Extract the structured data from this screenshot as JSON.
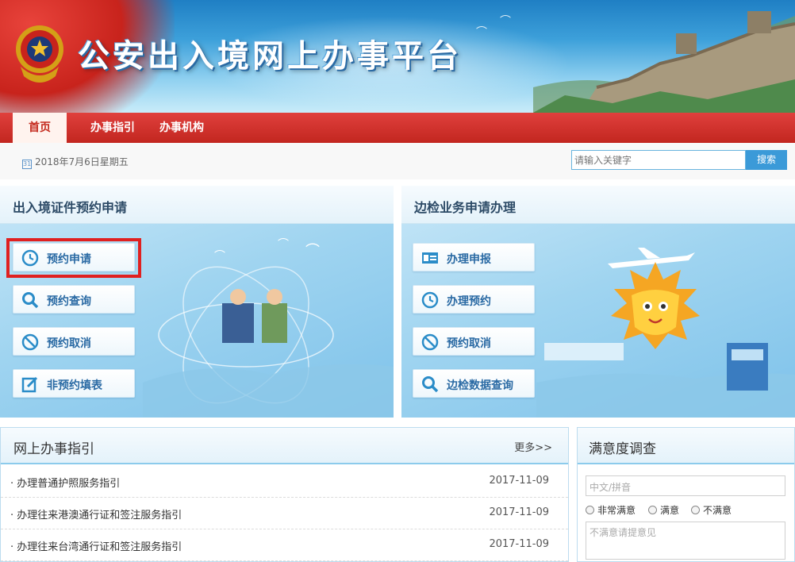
{
  "header": {
    "title": "公安出入境网上办事平台"
  },
  "nav": {
    "items": [
      {
        "label": "首页",
        "active": true
      },
      {
        "label": "办事指引",
        "active": false
      },
      {
        "label": "办事机构",
        "active": false
      }
    ]
  },
  "info": {
    "date": "2018年7月6日星期五",
    "search_placeholder": "请输入关键字",
    "search_button": "搜索"
  },
  "left_panel": {
    "title": "出入境证件预约申请",
    "buttons": [
      {
        "label": "预约申请",
        "icon": "clock-icon"
      },
      {
        "label": "预约查询",
        "icon": "search-icon"
      },
      {
        "label": "预约取消",
        "icon": "cancel-icon"
      },
      {
        "label": "非预约填表",
        "icon": "edit-icon"
      }
    ]
  },
  "right_panel": {
    "title": "边检业务申请办理",
    "buttons": [
      {
        "label": "办理申报",
        "icon": "id-card-icon"
      },
      {
        "label": "办理预约",
        "icon": "clock-icon"
      },
      {
        "label": "预约取消",
        "icon": "cancel-icon"
      },
      {
        "label": "边检数据查询",
        "icon": "search-icon"
      }
    ]
  },
  "guide": {
    "title": "网上办事指引",
    "more": "更多>>",
    "items": [
      {
        "title": "· 办理普通护照服务指引",
        "date": "2017-11-09"
      },
      {
        "title": "· 办理往来港澳通行证和签注服务指引",
        "date": "2017-11-09"
      },
      {
        "title": "· 办理往来台湾通行证和签注服务指引",
        "date": "2017-11-09"
      }
    ]
  },
  "survey": {
    "title": "满意度调查",
    "name_placeholder": "中文/拼音",
    "options": [
      "非常满意",
      "满意",
      "不满意"
    ],
    "comment_placeholder": "不满意请提意见"
  },
  "colors": {
    "nav_red": "#c42a1e",
    "accent_blue": "#3b9ad8",
    "button_text": "#2a6aa4",
    "highlight_red": "#e02020"
  }
}
